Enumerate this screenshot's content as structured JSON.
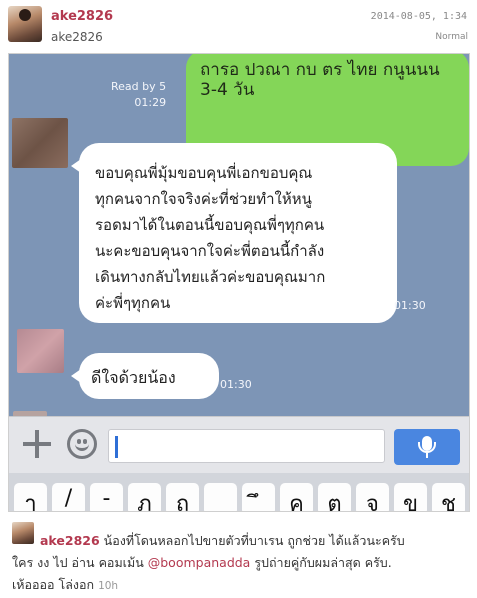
{
  "header": {
    "username": "ake2826",
    "subtitle": "ake2826",
    "date": "2014-08-05, 1:34",
    "status": "Normal"
  },
  "chat": {
    "outgoing_lines": [
      "ถารอ ปวณา กบ ตร ไทย กนูนนน",
      "3-4 วัน"
    ],
    "read_status": "Read by 5",
    "read_time": "01:29",
    "incoming_1": {
      "lines": [
        "ขอบคุณพี่มุ้มขอบคุนพี่เอกขอบคุณ",
        "ทุกคนจากใจจริงค่ะที่ช่วยทำให้หนู",
        "รอดมาได้ในตอนนี้ขอบคุณพี่ๆทุกคน",
        "นะคะขอบคุนจากใจค่ะพี่ตอนนี้กำลัง",
        "เดินทางกลับไทยแล้วค่ะขอบคุณมาก",
        "ค่ะพี่ๆทุกคน"
      ],
      "time": "01:30"
    },
    "incoming_2": {
      "text": "ดีใจด้วยน้อง",
      "time": "01:30"
    }
  },
  "input": {
    "placeholder": ""
  },
  "keyboard": {
    "keys": [
      "ๅ",
      "/",
      "-",
      "ภ",
      "ถ",
      "ุ",
      "ึ",
      "ค",
      "ต",
      "จ",
      "ข",
      "ช"
    ]
  },
  "caption": {
    "username": "ake2826",
    "line1": "น้องที่โดนหลอกไปขายตัวที่บาเรน ถูกช่วย ได้แล้วนะครับ",
    "line2_prefix": "ใคร งง ไป อ่าน คอมเม้น",
    "mention": "@boompanadda",
    "line2_suffix": "รูปถ่ายคู่กับผมล่าสุด ครับ.",
    "line3": "เห้ออออ โล่งอก",
    "time": "10h"
  },
  "colors": {
    "username": "#b3394f",
    "chat_bg": "#7d95b6",
    "outgoing_bubble": "#84d658",
    "mic_button": "#4a86e0"
  }
}
